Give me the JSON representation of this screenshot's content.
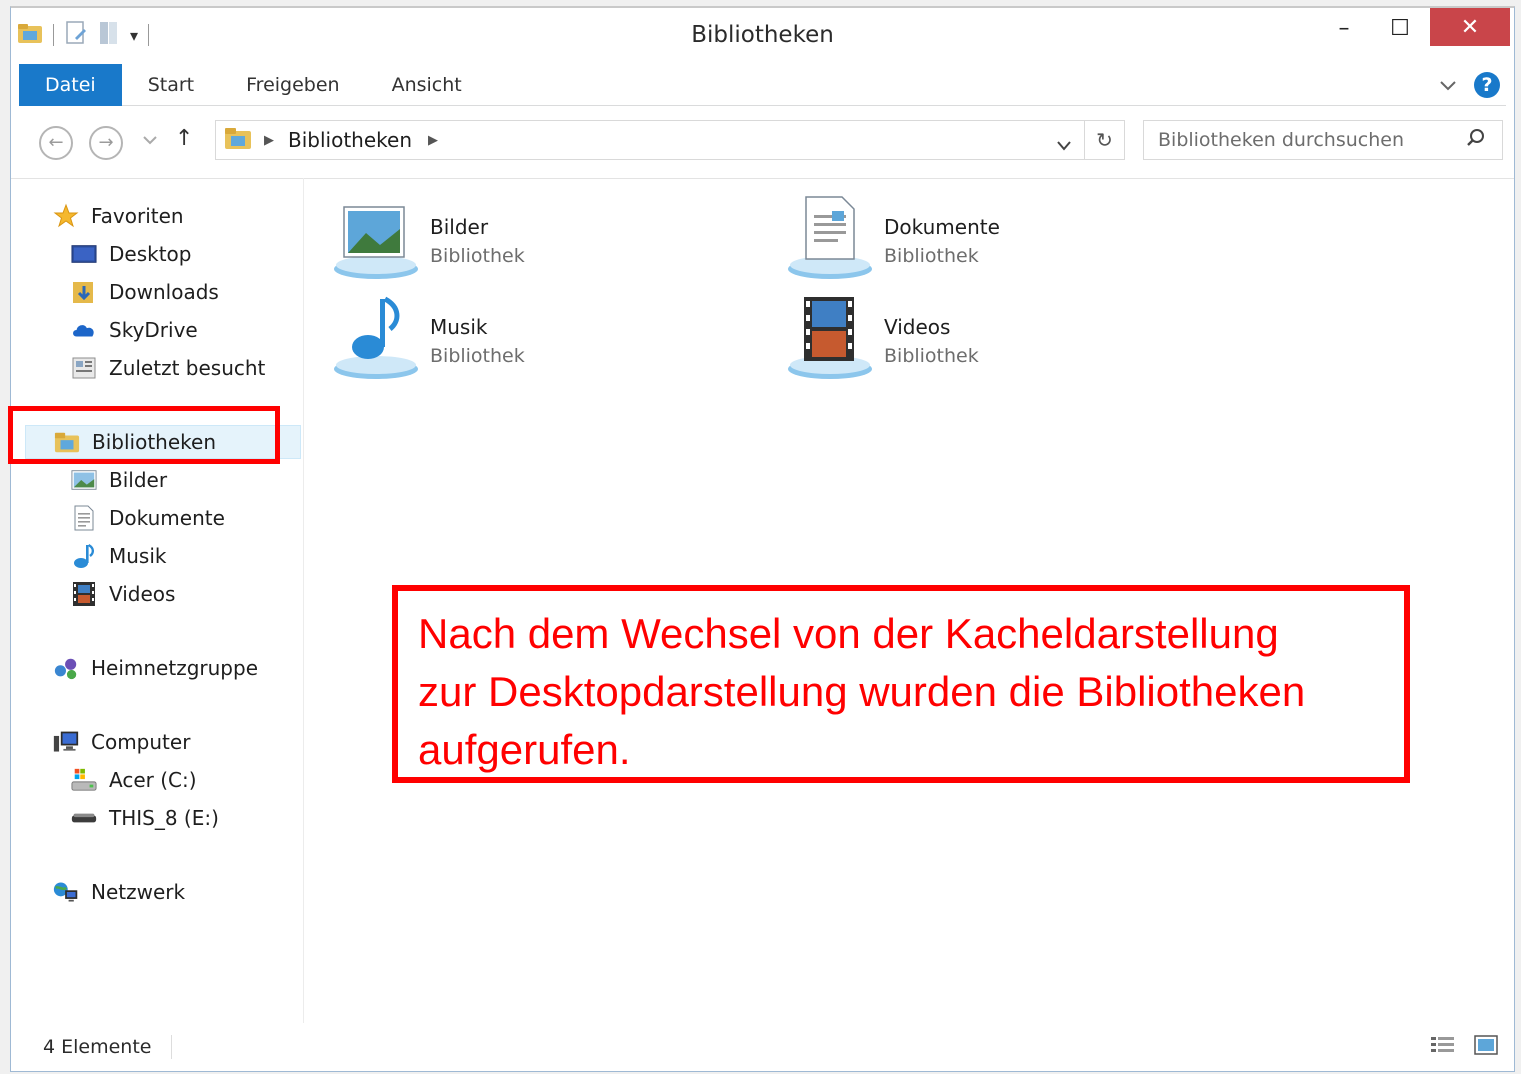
{
  "window": {
    "title": "Bibliotheken",
    "min": "–",
    "max": "☐",
    "close": "✕"
  },
  "ribbon": {
    "tabs": [
      "Datei",
      "Start",
      "Freigeben",
      "Ansicht"
    ],
    "help": "?"
  },
  "nav": {
    "back": "←",
    "forward": "→",
    "up": "↑",
    "refresh": "↻",
    "address": {
      "location": "Bibliotheken"
    },
    "search_placeholder": "Bibliotheken durchsuchen"
  },
  "sidebar": {
    "favorites": {
      "label": "Favoriten",
      "items": [
        "Desktop",
        "Downloads",
        "SkyDrive",
        "Zuletzt besucht"
      ]
    },
    "libraries": {
      "label": "Bibliotheken",
      "items": [
        "Bilder",
        "Dokumente",
        "Musik",
        "Videos"
      ]
    },
    "homegroup": "Heimnetzgruppe",
    "computer": {
      "label": "Computer",
      "items": [
        "Acer (C:)",
        "THIS_8 (E:)"
      ]
    },
    "network": "Netzwerk"
  },
  "libraries": [
    {
      "name": "Bilder",
      "type": "Bibliothek",
      "icon": "pictures-library-icon"
    },
    {
      "name": "Dokumente",
      "type": "Bibliothek",
      "icon": "documents-library-icon"
    },
    {
      "name": "Musik",
      "type": "Bibliothek",
      "icon": "music-library-icon"
    },
    {
      "name": "Videos",
      "type": "Bibliothek",
      "icon": "videos-library-icon"
    }
  ],
  "status": {
    "count": "4 Elemente"
  },
  "annotation": {
    "line1": "Nach dem Wechsel von der Kacheldarstellung",
    "line2": "zur Desktopdarstellung wurden die Bibliotheken",
    "line3": "aufgerufen."
  },
  "colors": {
    "accent": "#1979ca",
    "close": "#c9454a",
    "annotation": "#ff0000"
  }
}
